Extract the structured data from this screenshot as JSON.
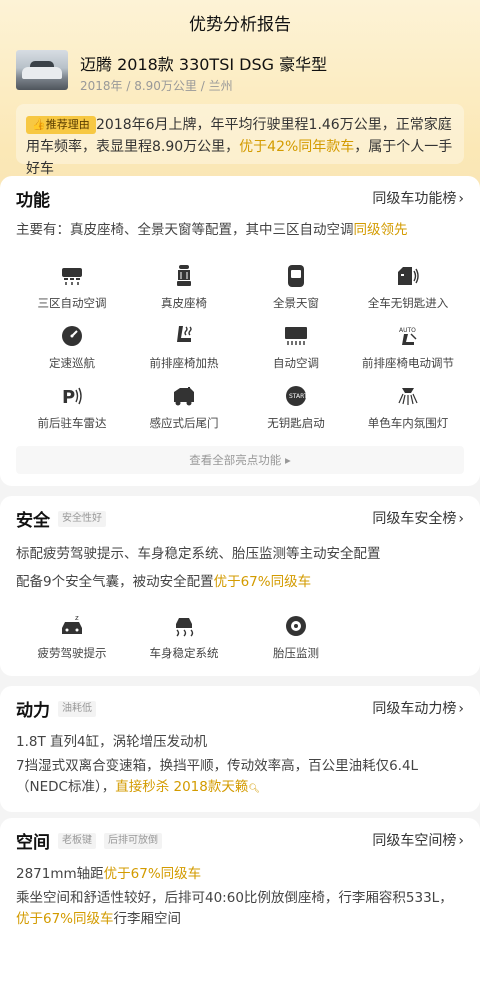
{
  "header": {
    "title": "优势分析报告"
  },
  "car": {
    "name": "迈腾 2018款 330TSI DSG 豪华型",
    "meta": "2018年 / 8.90万公里 / 兰州"
  },
  "reason": {
    "tag": "推荐理由",
    "text_a": "2018年6月上牌，年平均行驶里程1.46万公里，正常家庭用车频率，表显里程8.90万公里，",
    "text_hl": "优于42%同年款车",
    "text_b": "，属于个人一手好车"
  },
  "function": {
    "title": "功能",
    "link": "同级车功能榜",
    "desc_a": "主要有：真皮座椅、全景天窗等配置，其中三区自动空调",
    "desc_hl": "同级领先",
    "features": [
      {
        "label": "三区自动空调",
        "icon": "ac-icon"
      },
      {
        "label": "真皮座椅",
        "icon": "leather-seat-icon"
      },
      {
        "label": "全景天窗",
        "icon": "sunroof-icon"
      },
      {
        "label": "全车无钥匙进入",
        "icon": "keyless-entry-icon"
      },
      {
        "label": "定速巡航",
        "icon": "cruise-icon"
      },
      {
        "label": "前排座椅加热",
        "icon": "seat-heat-icon"
      },
      {
        "label": "自动空调",
        "icon": "auto-ac-icon"
      },
      {
        "label": "前排座椅电动调节",
        "icon": "seat-adjust-icon"
      },
      {
        "label": "前后驻车雷达",
        "icon": "parking-radar-icon"
      },
      {
        "label": "感应式后尾门",
        "icon": "tailgate-icon"
      },
      {
        "label": "无钥匙启动",
        "icon": "push-start-icon"
      },
      {
        "label": "单色车内氛围灯",
        "icon": "ambient-light-icon"
      }
    ],
    "more": "查看全部亮点功能"
  },
  "safety": {
    "title": "安全",
    "tag": "安全性好",
    "link": "同级车安全榜",
    "line1": "标配疲劳驾驶提示、车身稳定系统、胎压监测等主动安全配置",
    "line2_a": "配备9个安全气囊，被动安全配置",
    "line2_hl": "优于67%同级车",
    "features": [
      {
        "label": "疲劳驾驶提示",
        "icon": "fatigue-icon"
      },
      {
        "label": "车身稳定系统",
        "icon": "stability-icon"
      },
      {
        "label": "胎压监测",
        "icon": "tire-pressure-icon"
      }
    ]
  },
  "power": {
    "title": "动力",
    "tag": "油耗低",
    "link": "同级车动力榜",
    "line1": "1.8T 直列4缸，涡轮增压发动机",
    "line2_a": "7挡湿式双离合变速箱，换挡平顺，传动效率高，百公里油耗仅6.4L（NEDC标准），",
    "line2_hl": "直接秒杀 2018款天籁"
  },
  "space": {
    "title": "空间",
    "tags": [
      "老板键",
      "后排可放倒"
    ],
    "link": "同级车空间榜",
    "line1_a": "2871mm轴距",
    "line1_hl": "优于67%同级车",
    "line2_a": "乘坐空间和舒适性较好，后排可40:60比例放倒座椅，行李厢容积533L，",
    "line2_hl": "优于67%同级车",
    "line2_b": "行李厢空间"
  },
  "colors": {
    "accent": "#d39b00",
    "tag_bg": "#f7c843",
    "hero_bg": "#fbe8b6"
  }
}
